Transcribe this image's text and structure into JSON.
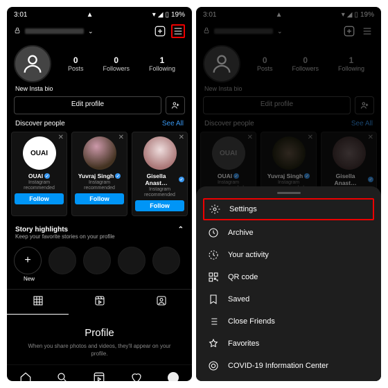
{
  "status": {
    "time": "3:01",
    "battery": "19%"
  },
  "header": {
    "add_icon": "⊞",
    "menu_icon": "≡"
  },
  "stats": [
    {
      "num": "0",
      "label": "Posts"
    },
    {
      "num": "0",
      "label": "Followers"
    },
    {
      "num": "1",
      "label": "Following"
    }
  ],
  "bio": "New Insta bio",
  "edit_profile": "Edit profile",
  "discover": {
    "title": "Discover people",
    "see_all": "See All"
  },
  "cards": [
    {
      "name": "OUAI",
      "sub": "Instagram\nrecommended",
      "btn": "Follow",
      "bg": "#fff",
      "fg": "#000",
      "text": "OUAI"
    },
    {
      "name": "Yuvraj Singh",
      "sub": "Instagram\nrecommended",
      "btn": "Follow",
      "bg": "#2b2b2b",
      "fg": "#fff",
      "text": ""
    },
    {
      "name": "Gisella Anast…",
      "sub": "Instagram\nrecommended",
      "btn": "Follow",
      "bg": "#bfa",
      "fg": "#000",
      "text": ""
    }
  ],
  "story": {
    "title": "Story highlights",
    "sub": "Keep your favorite stories on your profile",
    "new": "New"
  },
  "empty": {
    "h": "Profile",
    "p": "When you share photos and videos, they'll appear on your profile."
  },
  "menu": [
    {
      "icon": "gear",
      "label": "Settings",
      "hl": true
    },
    {
      "icon": "archive",
      "label": "Archive"
    },
    {
      "icon": "activity",
      "label": "Your activity"
    },
    {
      "icon": "qr",
      "label": "QR code"
    },
    {
      "icon": "saved",
      "label": "Saved"
    },
    {
      "icon": "friends",
      "label": "Close Friends"
    },
    {
      "icon": "star",
      "label": "Favorites"
    },
    {
      "icon": "covid",
      "label": "COVID-19 Information Center"
    }
  ]
}
